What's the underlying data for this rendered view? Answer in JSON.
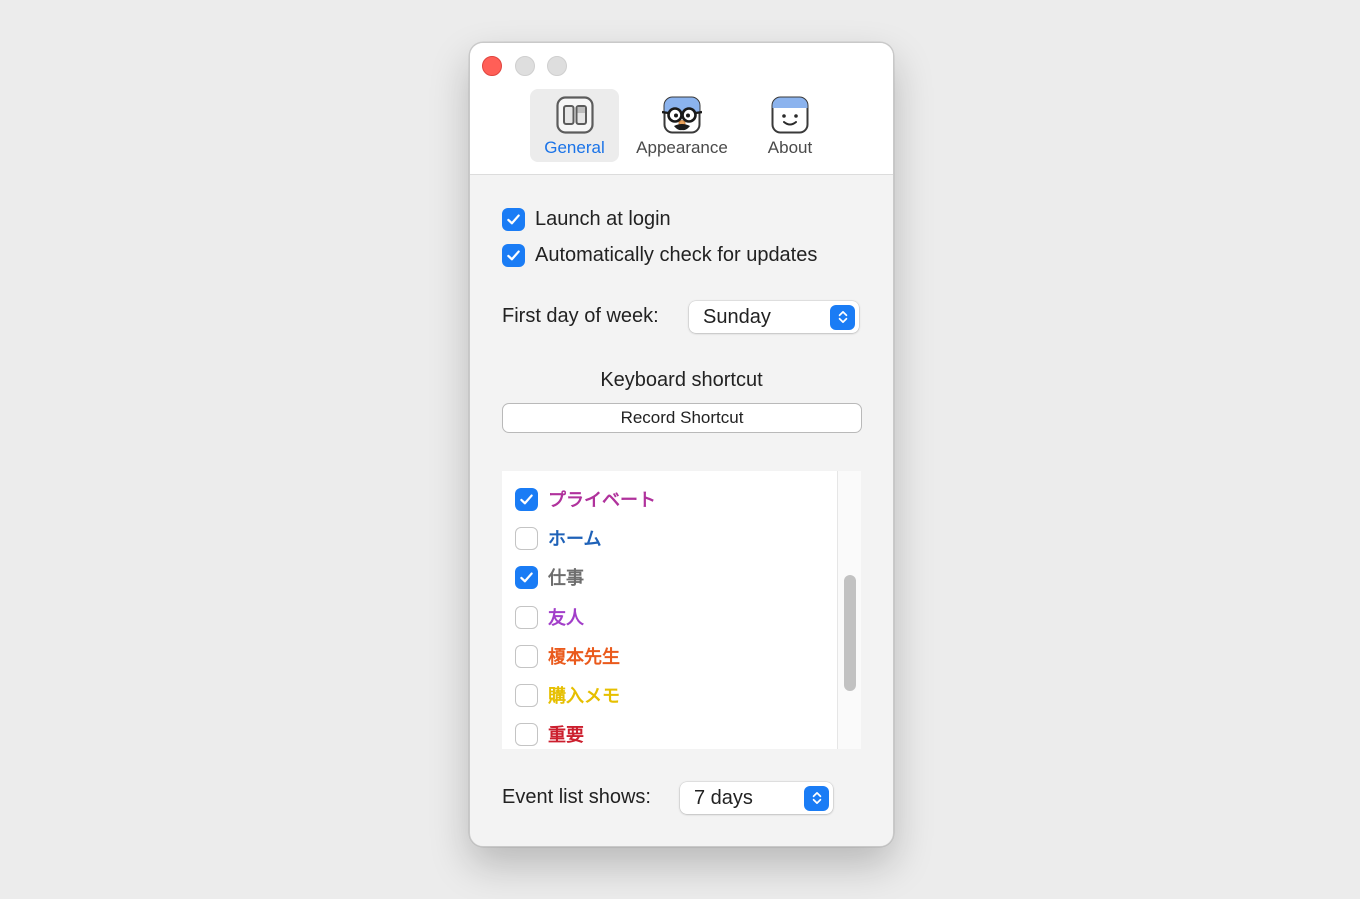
{
  "window": {
    "tabs": [
      {
        "label": "General",
        "icon": "general-panels-icon",
        "active": true
      },
      {
        "label": "Appearance",
        "icon": "glasses-face-icon",
        "active": false
      },
      {
        "label": "About",
        "icon": "smiley-app-icon",
        "active": false
      }
    ]
  },
  "general": {
    "launch_at_login": {
      "label": "Launch at login",
      "checked": true
    },
    "auto_check_updates": {
      "label": "Automatically check for updates",
      "checked": true
    },
    "first_day_of_week": {
      "label": "First day of week:",
      "value": "Sunday"
    },
    "keyboard_shortcut": {
      "title": "Keyboard shortcut",
      "button_label": "Record Shortcut"
    },
    "calendars": [
      {
        "label": "プライベート",
        "checked": true,
        "color": "#b0329c"
      },
      {
        "label": "ホーム",
        "checked": false,
        "color": "#1f62b8"
      },
      {
        "label": "仕事",
        "checked": true,
        "color": "#6e6e6e"
      },
      {
        "label": "友人",
        "checked": false,
        "color": "#a23ec9"
      },
      {
        "label": "榎本先生",
        "checked": false,
        "color": "#ea5a1c"
      },
      {
        "label": "購入メモ",
        "checked": false,
        "color": "#e6bf00"
      },
      {
        "label": "重要",
        "checked": false,
        "color": "#cc1f2e"
      }
    ],
    "event_list_shows": {
      "label": "Event list shows:",
      "value": "7 days"
    }
  },
  "colors": {
    "accent": "#1a7cf5",
    "close_button": "#ff5f57"
  }
}
